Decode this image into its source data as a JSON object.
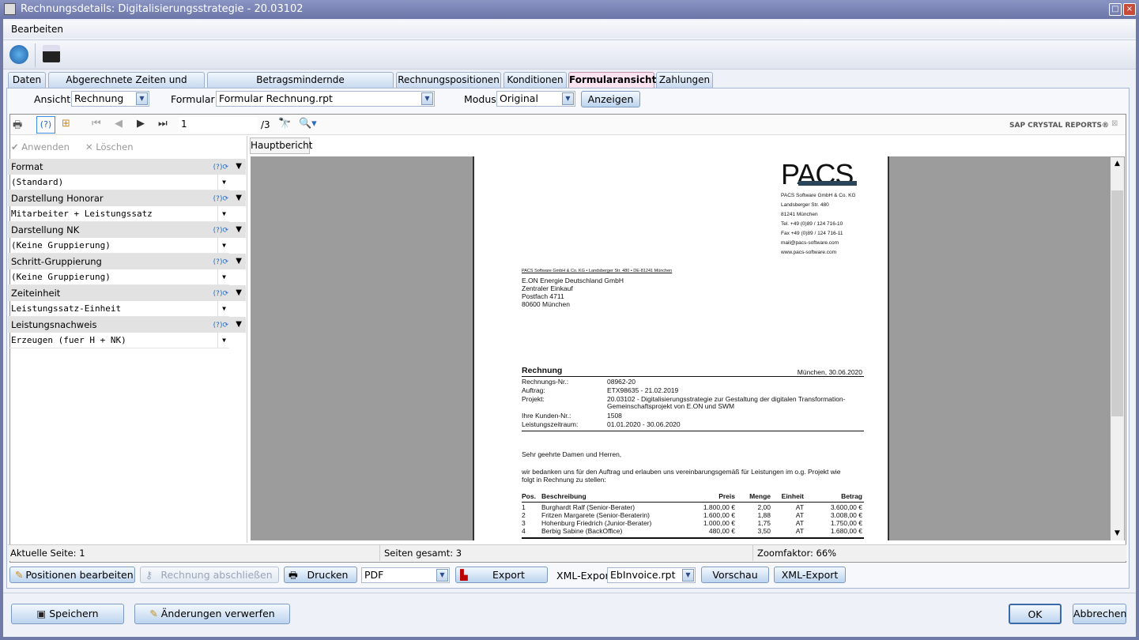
{
  "window": {
    "title": "Rechnungsdetails: Digitalisierungsstrategie - 20.03102"
  },
  "menu": {
    "bearbeiten": "Bearbeiten"
  },
  "tabs": [
    "Daten",
    "Abgerechnete Zeiten und Kosten",
    "Betragsmindernde Abschlagszahlungen",
    "Rechnungspositionen",
    "Konditionen",
    "Formularansicht",
    "Zahlungen"
  ],
  "filter": {
    "ansicht_label": "Ansicht",
    "ansicht_value": "Rechnung",
    "formular_label": "Formular",
    "formular_value": "Formular Rechnung.rpt",
    "modus_label": "Modus",
    "modus_value": "Original",
    "anzeigen": "Anzeigen"
  },
  "viewer": {
    "page_input": "1",
    "page_total": "/3",
    "brand": "SAP CRYSTAL REPORTS®",
    "apply": "Anwenden",
    "delete": "Löschen",
    "report_tab": "Hauptbericht"
  },
  "parameters": [
    {
      "label": "Format",
      "value": "(Standard)"
    },
    {
      "label": "Darstellung Honorar",
      "value": "Mitarbeiter + Leistungssatz"
    },
    {
      "label": "Darstellung NK",
      "value": "(Keine Gruppierung)"
    },
    {
      "label": "Schritt-Gruppierung",
      "value": "(Keine Gruppierung)"
    },
    {
      "label": "Zeiteinheit",
      "value": "Leistungssatz-Einheit"
    },
    {
      "label": "Leistungsnachweis",
      "value": "Erzeugen (fuer H + NK)"
    }
  ],
  "invoice": {
    "logo": "PACS",
    "sender": [
      "PACS Software GmbH & Co. KG",
      "Landsberger Str. 480",
      "81241 München",
      "Tel.   +49 (0)89 / 124 716-10",
      "Fax  +49 (0)89 / 124 716-11",
      "mail@pacs-software.com",
      "www.pacs-software.com"
    ],
    "sender_line": "PACS Software GmbH & Co. KG • Landsberger Str. 480 • DE-81241 München",
    "recipient": [
      "E.ON Energie Deutschland GmbH",
      "Zentraler Einkauf",
      "Postfach 4711",
      "80600 München"
    ],
    "title": "Rechnung",
    "date": "München, 30.06.2020",
    "meta": [
      {
        "k": "Rechnungs-Nr.:",
        "v": "08962-20"
      },
      {
        "k": "Auftrag:",
        "v": "ETX98635 - 21.02.2019"
      },
      {
        "k": "Projekt:",
        "v": "20.03102 - Digitalisierungsstrategie zur Gestaltung der digitalen Transformation-",
        "v2": "Gemeinschaftsprojekt von E.ON und SWM"
      },
      {
        "k": "Ihre Kunden-Nr.:",
        "v": "1508"
      },
      {
        "k": "Leistungszeitraum:",
        "v": "01.01.2020 - 30.06.2020"
      }
    ],
    "greeting": "Sehr geehrte Damen und Herren,",
    "body1": "wir bedanken uns für den Auftrag und erlauben uns vereinbarungsgemäß für Leistungen im o.g. Projekt wie",
    "body2": "folgt in Rechnung zu stellen:",
    "columns": [
      "Pos.",
      "Beschreibung",
      "Preis",
      "Menge",
      "Einheit",
      "Betrag"
    ],
    "rows": [
      [
        "1",
        "Burghardt Ralf  (Senior-Berater)",
        "1.800,00 €",
        "2,00",
        "AT",
        "3.600,00 €"
      ],
      [
        "2",
        "Fritzen Margarete (Senior-Beraterin)",
        "1.600,00 €",
        "1,88",
        "AT",
        "3.008,00 €"
      ],
      [
        "3",
        "Hohenburg Friedrich (Junior-Berater)",
        "1.000,00 €",
        "1,75",
        "AT",
        "1.750,00 €"
      ],
      [
        "4",
        "Berbig Sabine (BackOffice)",
        "480,00 €",
        "3,50",
        "AT",
        "1.680,00 €"
      ]
    ]
  },
  "status": {
    "current": "Aktuelle Seite: 1",
    "total": "Seiten gesamt: 3",
    "zoom": "Zoomfaktor: 66%"
  },
  "actions": {
    "positions": "Positionen bearbeiten",
    "close_invoice": "Rechnung abschließen",
    "print": "Drucken",
    "format": "PDF",
    "export": "Export",
    "xml_label": "XML-Export",
    "xml_value": "EbInvoice.rpt",
    "preview": "Vorschau",
    "xml_export": "XML-Export"
  },
  "footer": {
    "save": "Speichern",
    "discard": "Änderungen verwerfen",
    "ok": "OK",
    "cancel": "Abbrechen"
  }
}
